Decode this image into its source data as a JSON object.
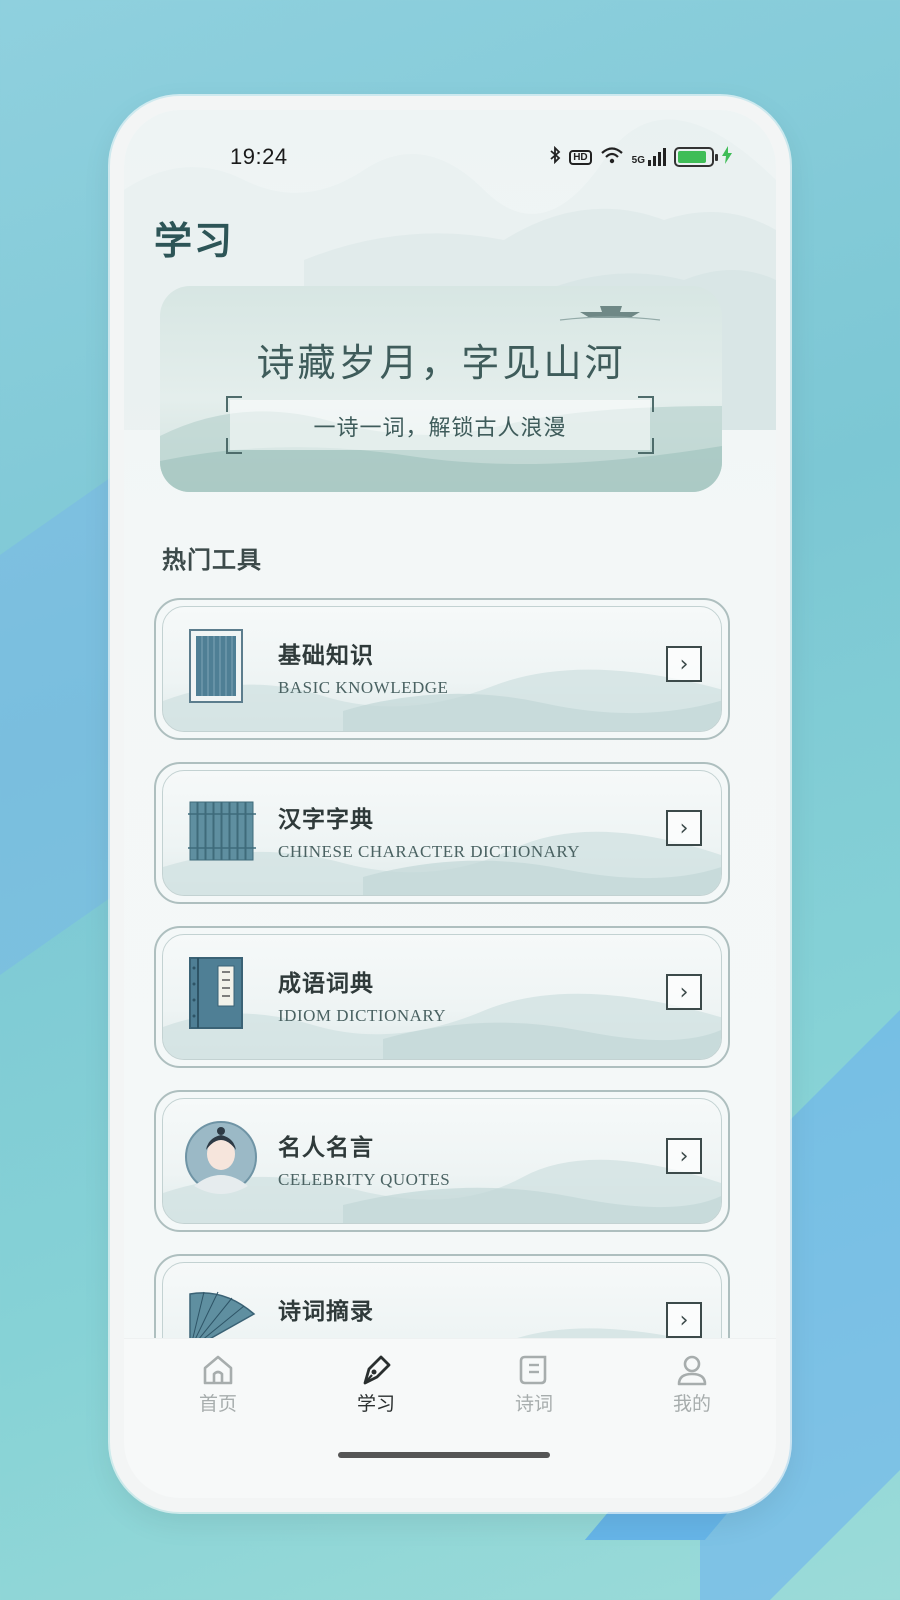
{
  "status_bar": {
    "time": "19:24",
    "icons": [
      "bluetooth-icon",
      "hd-icon",
      "wifi-icon",
      "5g-signal-icon",
      "battery-icon",
      "charging-icon"
    ],
    "hd_label": "HD",
    "network_label": "5G",
    "battery_color": "#3fbd57"
  },
  "header": {
    "title": "学习"
  },
  "banner": {
    "title": "诗藏岁月，字见山河",
    "subtitle": "一诗一词，解锁古人浪漫"
  },
  "section": {
    "title": "热门工具"
  },
  "tools": [
    {
      "name": "基础知识",
      "en": "BASIC KNOWLEDGE",
      "icon": "book-page-icon"
    },
    {
      "name": "汉字字典",
      "en": "CHINESE CHARACTER DICTIONARY",
      "icon": "bamboo-slips-icon"
    },
    {
      "name": "成语词典",
      "en": "IDIOM DICTIONARY",
      "icon": "thread-bound-book-icon"
    },
    {
      "name": "名人名言",
      "en": "CELEBRITY QUOTES",
      "icon": "scholar-avatar-icon"
    },
    {
      "name": "诗词摘录",
      "en": "",
      "icon": "folding-fan-icon"
    }
  ],
  "tabbar": {
    "items": [
      {
        "label": "首页",
        "icon": "home-icon",
        "active": false
      },
      {
        "label": "学习",
        "icon": "pen-icon",
        "active": true
      },
      {
        "label": "诗词",
        "icon": "scroll-icon",
        "active": false
      },
      {
        "label": "我的",
        "icon": "user-icon",
        "active": false
      }
    ]
  },
  "colors": {
    "accent": "#2d5557",
    "active_tab": "#2a2f2f",
    "inactive_tab": "#a7adad"
  }
}
